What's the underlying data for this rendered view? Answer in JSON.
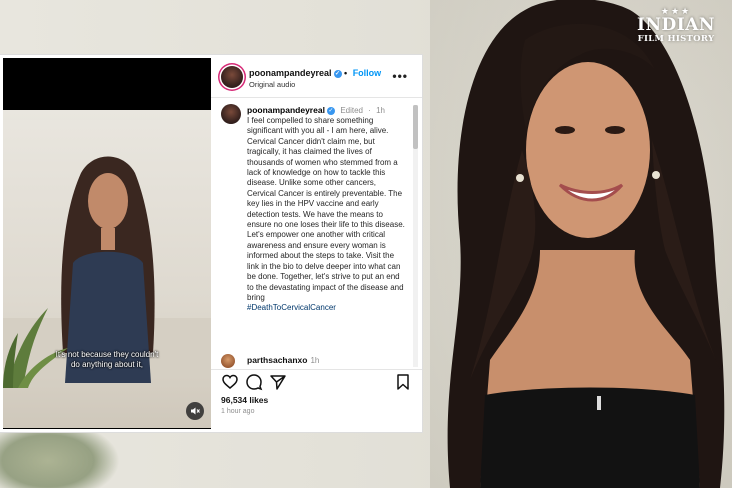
{
  "watermark": {
    "line1": "INDIAN",
    "line2": "FILM HISTORY",
    "stars": "★★★"
  },
  "post": {
    "username": "poonampandeyreal",
    "follow_label": "Follow",
    "audio_label": "Original audio",
    "more_label": "•••",
    "video_caption_line1": "It's not because they couldn't",
    "video_caption_line2": "do anything about it,",
    "mute_icon": "speaker-muted-icon",
    "comment": {
      "username": "poonampandeyreal",
      "edited": "Edited",
      "time": "1h",
      "text": "I feel compelled to share something significant with you all - I am here, alive. Cervical Cancer didn't claim me, but tragically, it has claimed the lives of thousands of women who stemmed from a lack of knowledge on how to tackle this disease. Unlike some other cancers, Cervical Cancer is entirely preventable. The key lies in the HPV vaccine and early detection tests. We have the means to ensure no one loses their life to this disease. Let's empower one another with critical awareness and ensure every woman is informed about the steps to take. Visit the link in the bio to delve deeper into what can be done. Together, let's strive to put an end to the devastating impact of the disease and bring",
      "hashtag": "#DeathToCervicalCancer"
    },
    "reply": {
      "username": "parthsachanxo",
      "time": "1h"
    },
    "likes": "96,534 likes",
    "posted": "1 hour ago"
  },
  "colors": {
    "link_blue": "#0095f6",
    "hashtag": "#00376b",
    "verified": "#3897f0"
  }
}
